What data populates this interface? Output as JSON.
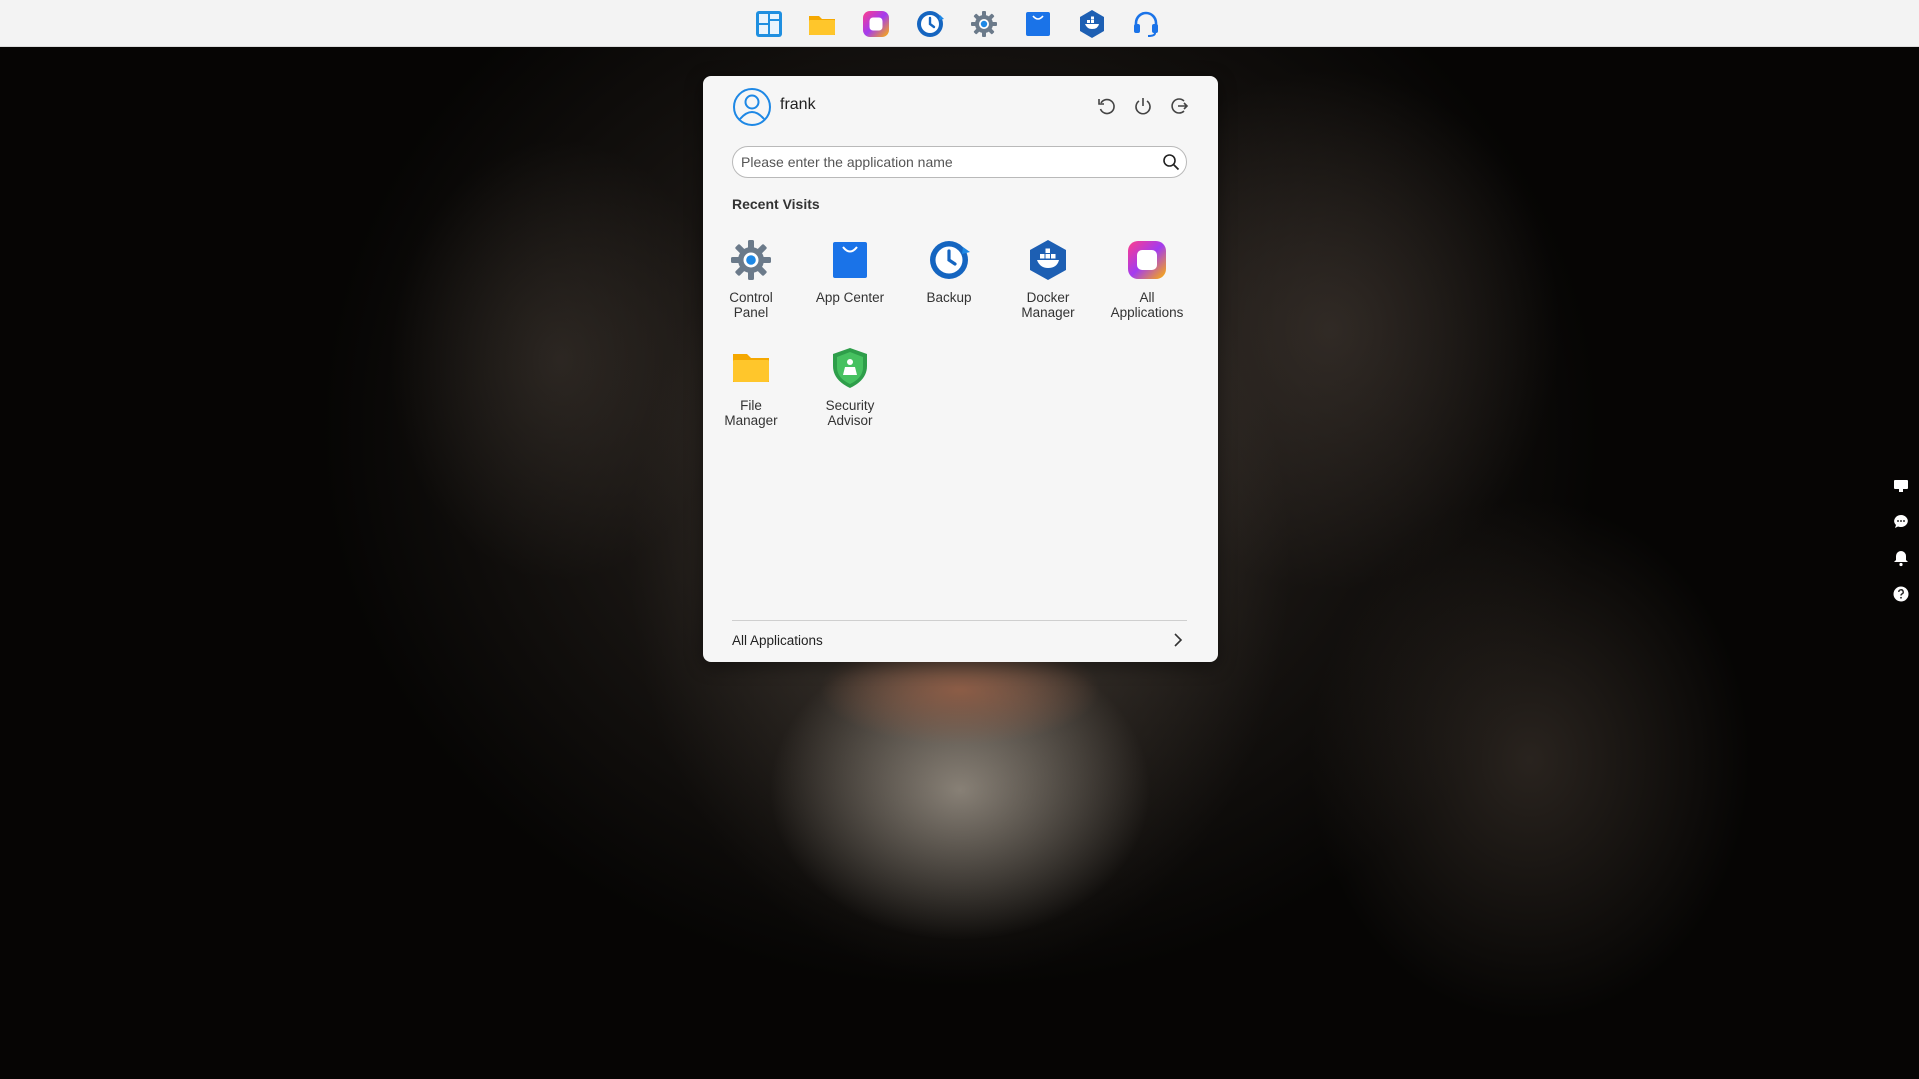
{
  "taskbar": {
    "icons": [
      "launcher-icon",
      "file-manager-icon",
      "all-applications-icon",
      "backup-icon",
      "control-panel-icon",
      "app-center-icon",
      "docker-icon",
      "support-headset-icon"
    ]
  },
  "start_menu": {
    "user": {
      "name": "frank"
    },
    "header_buttons": [
      "restart-icon",
      "power-icon",
      "logout-icon"
    ],
    "search": {
      "placeholder": "Please enter the application name",
      "value": ""
    },
    "section_title": "Recent Visits",
    "recent_apps": [
      {
        "label": "Control\nPanel",
        "icon": "gear-icon"
      },
      {
        "label": "App Center",
        "icon": "shopping-bag-icon"
      },
      {
        "label": "Backup",
        "icon": "clock-icon"
      },
      {
        "label": "Docker\nManager",
        "icon": "docker-whale-icon"
      },
      {
        "label": "All\nApplications",
        "icon": "grid-square-icon"
      },
      {
        "label": "File\nManager",
        "icon": "folder-icon"
      },
      {
        "label": "Security\nAdvisor",
        "icon": "shield-icon"
      }
    ],
    "all_apps_link": "All Applications"
  },
  "right_side_icons": [
    "screen-icon",
    "chat-icon",
    "bell-icon",
    "help-icon"
  ],
  "colors": {
    "accent_blue": "#1a73e8",
    "folder_yellow": "#f7b500",
    "panel_bg": "#f6f6f6",
    "topbar_bg": "#f3f3f3"
  }
}
